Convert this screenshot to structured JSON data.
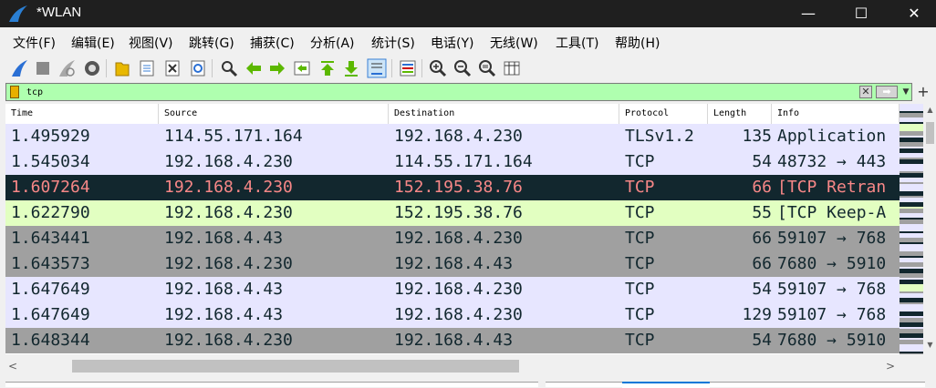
{
  "window": {
    "title": "*WLAN",
    "controls": {
      "minimize": "—",
      "maximize": "☐",
      "close": "✕"
    }
  },
  "menu": [
    {
      "label": "文件(F)"
    },
    {
      "label": "编辑(E)"
    },
    {
      "label": "视图(V)"
    },
    {
      "label": "跳转(G)"
    },
    {
      "label": "捕获(C)"
    },
    {
      "label": "分析(A)"
    },
    {
      "label": "统计(S)"
    },
    {
      "label": "电话(Y)"
    },
    {
      "label": "无线(W)"
    },
    {
      "label": "工具(T)"
    },
    {
      "label": "帮助(H)"
    }
  ],
  "toolbar": [
    "shark-fin-start-icon",
    "stop-square-icon",
    "restart-fin-icon",
    "capture-options-gear-icon",
    "open-folder-icon",
    "save-file-icon",
    "close-file-icon",
    "reload-icon",
    "find-magnifier-icon",
    "go-back-arrow-icon",
    "go-forward-arrow-icon",
    "go-to-packet-icon",
    "first-packet-arrow-icon",
    "last-packet-arrow-icon",
    "autoscroll-icon",
    "colorize-icon",
    "zoom-in-icon",
    "zoom-out-icon",
    "normal-size-icon",
    "resize-columns-icon"
  ],
  "filter": {
    "value": "tcp",
    "bookmark_icon": "bookmark-icon",
    "clear_icon": "clear-x-icon",
    "apply_icon": "apply-arrow-icon",
    "dropdown_icon": "dropdown-arrow-icon",
    "add_icon": "+"
  },
  "columns": [
    "Time",
    "Source",
    "Destination",
    "Protocol",
    "Length",
    "Info"
  ],
  "packets": [
    {
      "time": "1.495929",
      "source": "114.55.171.164",
      "destination": "192.168.4.230",
      "protocol": "TLSv1.2",
      "length": "135",
      "info": "Application",
      "bg": "#e7e6ff",
      "fg": "#12272e"
    },
    {
      "time": "1.545034",
      "source": "192.168.4.230",
      "destination": "114.55.171.164",
      "protocol": "TCP",
      "length": "54",
      "info": "48732 → 443",
      "bg": "#e7e6ff",
      "fg": "#12272e"
    },
    {
      "time": "1.607264",
      "source": "192.168.4.230",
      "destination": "152.195.38.76",
      "protocol": "TCP",
      "length": "66",
      "info": "[TCP Retran",
      "bg": "#12272e",
      "fg": "#f78787"
    },
    {
      "time": "1.622790",
      "source": "192.168.4.230",
      "destination": "152.195.38.76",
      "protocol": "TCP",
      "length": "55",
      "info": "[TCP Keep-A",
      "bg": "#e2ffc1",
      "fg": "#12272e"
    },
    {
      "time": "1.643441",
      "source": "192.168.4.43",
      "destination": "192.168.4.230",
      "protocol": "TCP",
      "length": "66",
      "info": "59107 → 768",
      "bg": "#a0a0a0",
      "fg": "#12272e"
    },
    {
      "time": "1.643573",
      "source": "192.168.4.230",
      "destination": "192.168.4.43",
      "protocol": "TCP",
      "length": "66",
      "info": "7680 → 5910",
      "bg": "#a0a0a0",
      "fg": "#12272e"
    },
    {
      "time": "1.647649",
      "source": "192.168.4.43",
      "destination": "192.168.4.230",
      "protocol": "TCP",
      "length": "54",
      "info": "59107 → 768",
      "bg": "#e7e6ff",
      "fg": "#12272e"
    },
    {
      "time": "1.647649",
      "source": "192.168.4.43",
      "destination": "192.168.4.230",
      "protocol": "TCP",
      "length": "129",
      "info": "59107 → 768",
      "bg": "#e7e6ff",
      "fg": "#12272e"
    },
    {
      "time": "1.648344",
      "source": "192.168.4.230",
      "destination": "192.168.4.43",
      "protocol": "TCP",
      "length": "54",
      "info": "7680 → 5910",
      "bg": "#a0a0a0",
      "fg": "#12272e"
    }
  ],
  "scrollbars": {
    "up_arrow": "▲",
    "down_arrow": "▼",
    "left_arrow": "<",
    "right_arrow": ">"
  },
  "colors": {
    "filter_valid_bg": "#afffaf",
    "titlebar_bg": "#1f1f1f",
    "selected_pane_accent": "#0078d7"
  }
}
